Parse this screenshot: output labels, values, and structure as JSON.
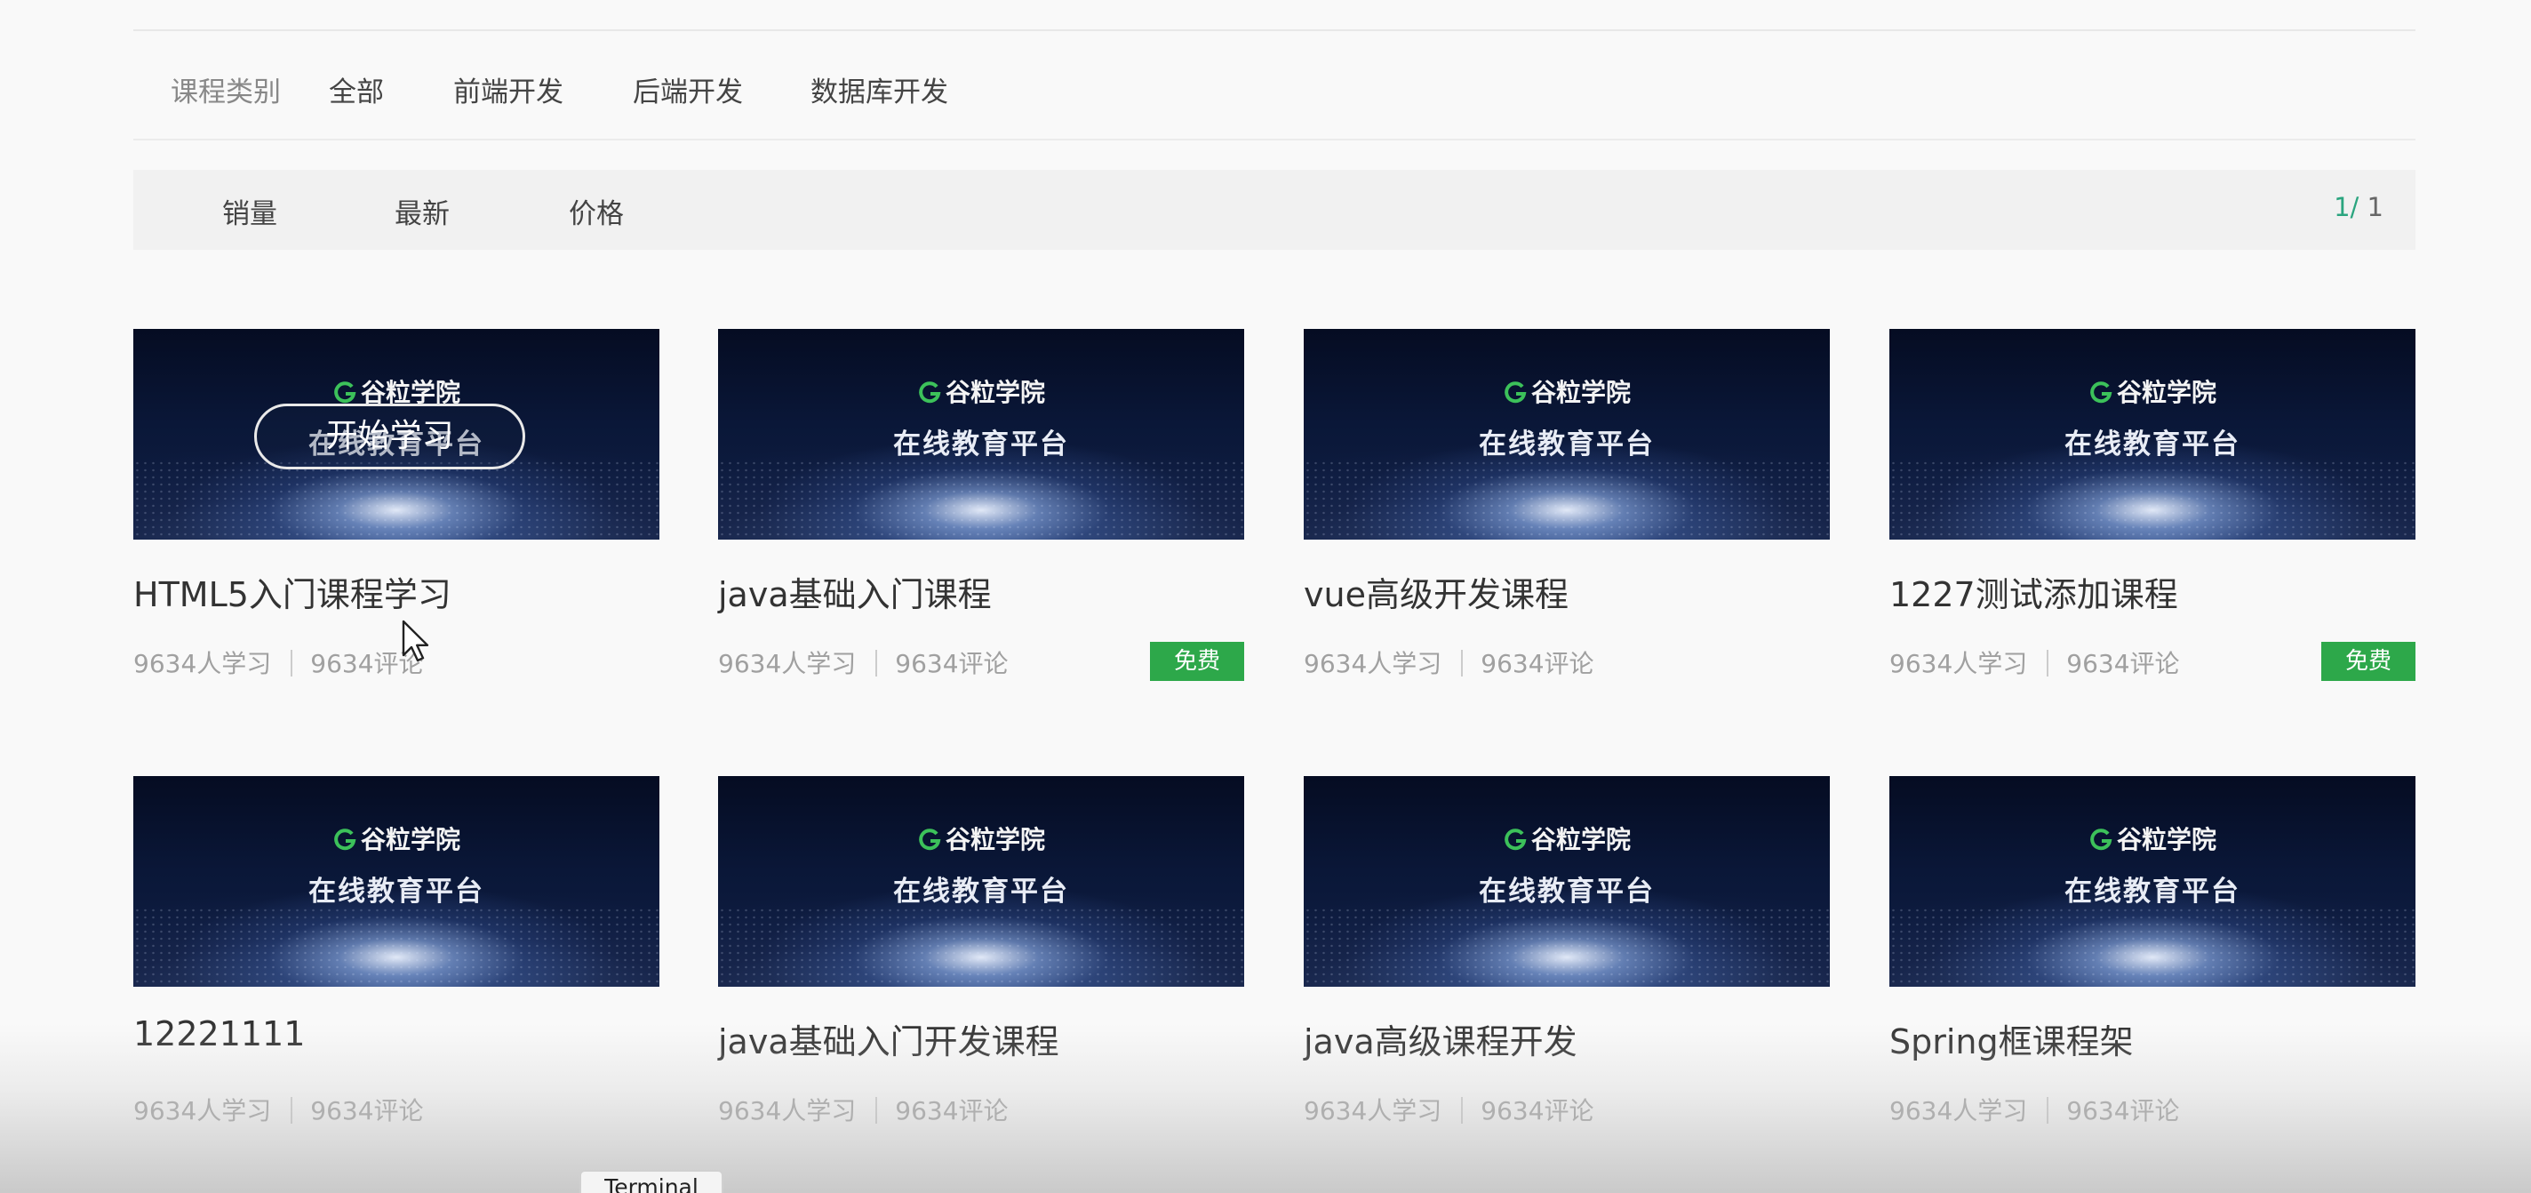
{
  "category_bar": {
    "label": "课程类别",
    "items": [
      {
        "label": "全部"
      },
      {
        "label": "前端开发"
      },
      {
        "label": "后端开发"
      },
      {
        "label": "数据库开发"
      }
    ]
  },
  "sort_bar": {
    "items": [
      {
        "label": "销量"
      },
      {
        "label": "最新"
      },
      {
        "label": "价格"
      }
    ],
    "pager": {
      "current": "1",
      "separator": "/",
      "total": " 1"
    }
  },
  "thumbnail": {
    "brand": "谷粒学院",
    "platform": "在线教育平台",
    "hover_button": "开始学习"
  },
  "courses": [
    {
      "title": "HTML5入门课程学习",
      "learners": "9634人学习",
      "comments": "9634评论",
      "badge": ""
    },
    {
      "title": "java基础入门课程",
      "learners": "9634人学习",
      "comments": "9634评论",
      "badge": "免费"
    },
    {
      "title": "vue高级开发课程",
      "learners": "9634人学习",
      "comments": "9634评论",
      "badge": ""
    },
    {
      "title": "1227测试添加课程",
      "learners": "9634人学习",
      "comments": "9634评论",
      "badge": "免费"
    },
    {
      "title": "12221111",
      "learners": "9634人学习",
      "comments": "9634评论",
      "badge": ""
    },
    {
      "title": "java基础入门开发课程",
      "learners": "9634人学习",
      "comments": "9634评论",
      "badge": ""
    },
    {
      "title": "java高级课程开发",
      "learners": "9634人学习",
      "comments": "9634评论",
      "badge": ""
    },
    {
      "title": "Spring框课程架",
      "learners": "9634人学习",
      "comments": "9634评论",
      "badge": ""
    }
  ],
  "taskbar": {
    "terminal_tooltip": "Terminal"
  },
  "colors": {
    "accent_green": "#2da84a",
    "pager_current": "#2ba57f"
  }
}
